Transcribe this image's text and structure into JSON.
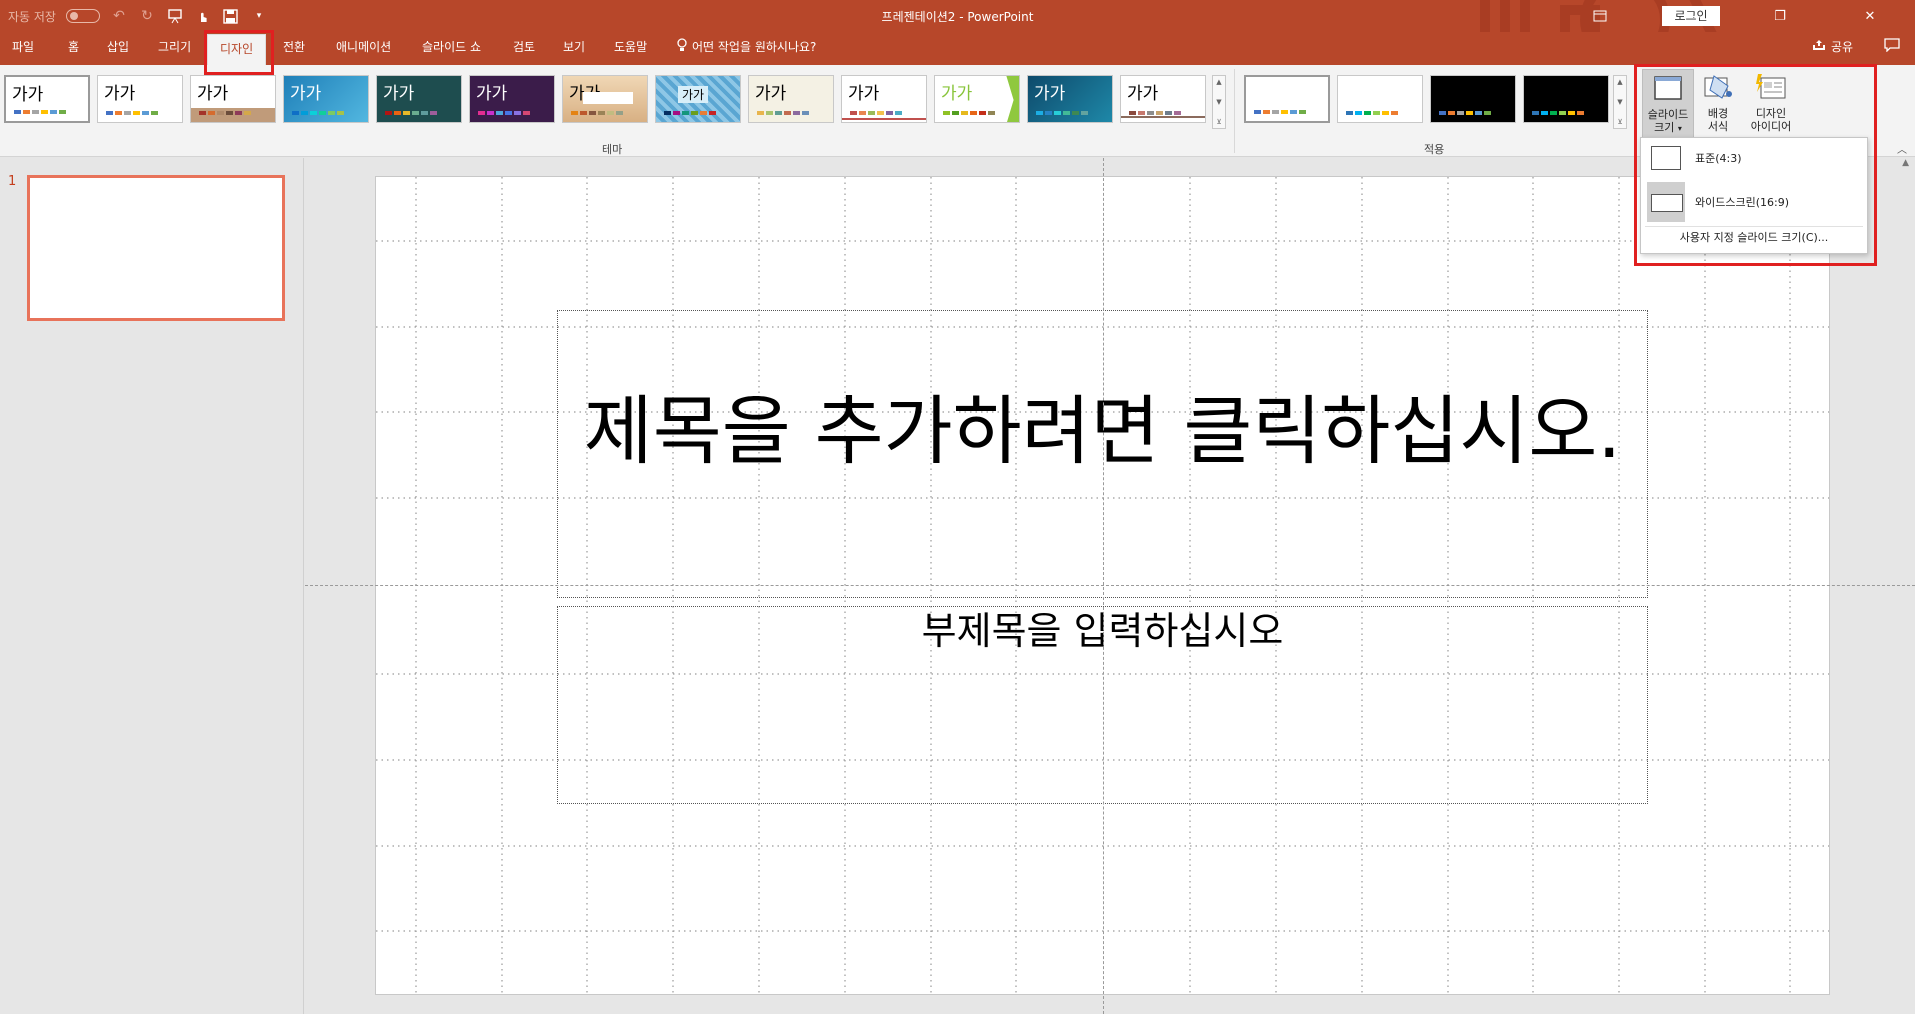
{
  "titlebar": {
    "autosave_label": "자동 저장",
    "doc_title": "프레젠테이션2  -  PowerPoint",
    "login_label": "로그인",
    "bg_color": "#b7472a"
  },
  "tabs": [
    {
      "label": "파일"
    },
    {
      "label": "홈"
    },
    {
      "label": "삽입"
    },
    {
      "label": "그리기"
    },
    {
      "label": "디자인"
    },
    {
      "label": "전환"
    },
    {
      "label": "애니메이션"
    },
    {
      "label": "슬라이드 쇼"
    },
    {
      "label": "검토"
    },
    {
      "label": "보기"
    },
    {
      "label": "도움말"
    }
  ],
  "active_tab": "디자인",
  "tellme": {
    "label": "어떤 작업을 원하시나요?"
  },
  "share": {
    "label": "공유"
  },
  "ribbon": {
    "theme_group_label": "테마",
    "variant_group_label": "적용",
    "theme_sample_text": "가가",
    "slide_size": {
      "label_line1": "슬라이드",
      "label_line2": "크기"
    },
    "format_background": {
      "label_line1": "배경",
      "label_line2": "서식"
    },
    "design_ideas": {
      "label_line1": "디자인",
      "label_line2": "아이디어"
    }
  },
  "slide_size_menu": {
    "standard_label": "표준(4:3)",
    "widescreen_label": "와이드스크린(16:9)",
    "custom_label": "사용자 지정 슬라이드 크기(C)..."
  },
  "thumbnail_panel": {
    "slide_number": "1"
  },
  "slide": {
    "title_placeholder": "제목을 추가하려면 클릭하십시오.",
    "subtitle_placeholder": "부제목을 입력하십시오"
  }
}
